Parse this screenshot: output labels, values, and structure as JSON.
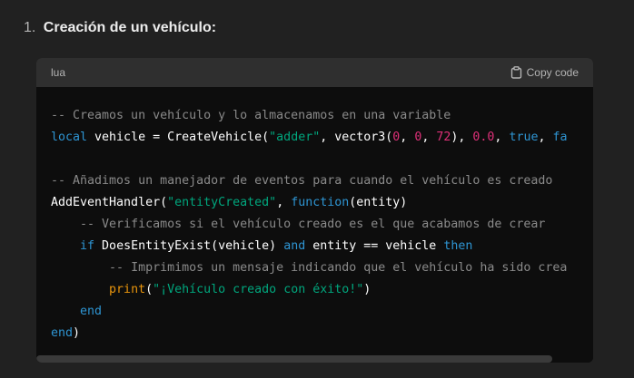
{
  "list_item": {
    "number": "1.",
    "text": "Creación de un vehículo:"
  },
  "code_block": {
    "language": "lua",
    "copy_label": "Copy code",
    "copy_icon": "clipboard-icon",
    "lines": [
      [
        {
          "t": "-- Creamos un vehículo y lo almacenamos en una variable",
          "c": "comment"
        }
      ],
      [
        {
          "t": "local",
          "c": "keyword"
        },
        {
          "t": " vehicle = CreateVehicle(",
          "c": "plain"
        },
        {
          "t": "\"adder\"",
          "c": "string"
        },
        {
          "t": ", vector3(",
          "c": "plain"
        },
        {
          "t": "0",
          "c": "number"
        },
        {
          "t": ", ",
          "c": "plain"
        },
        {
          "t": "0",
          "c": "number"
        },
        {
          "t": ", ",
          "c": "plain"
        },
        {
          "t": "72",
          "c": "number"
        },
        {
          "t": "), ",
          "c": "plain"
        },
        {
          "t": "0.0",
          "c": "number"
        },
        {
          "t": ", ",
          "c": "plain"
        },
        {
          "t": "true",
          "c": "keyword"
        },
        {
          "t": ", ",
          "c": "plain"
        },
        {
          "t": "fa",
          "c": "keyword"
        }
      ],
      [
        {
          "t": "",
          "c": "plain"
        }
      ],
      [
        {
          "t": "-- Añadimos un manejador de eventos para cuando el vehículo es creado",
          "c": "comment"
        }
      ],
      [
        {
          "t": "AddEventHandler(",
          "c": "plain"
        },
        {
          "t": "\"entityCreated\"",
          "c": "string"
        },
        {
          "t": ", ",
          "c": "plain"
        },
        {
          "t": "function",
          "c": "keyword"
        },
        {
          "t": "(entity)",
          "c": "plain"
        }
      ],
      [
        {
          "t": "    ",
          "c": "plain"
        },
        {
          "t": "-- Verificamos si el vehículo creado es el que acabamos de crear",
          "c": "comment"
        }
      ],
      [
        {
          "t": "    ",
          "c": "plain"
        },
        {
          "t": "if",
          "c": "keyword"
        },
        {
          "t": " DoesEntityExist(vehicle) ",
          "c": "plain"
        },
        {
          "t": "and",
          "c": "keyword"
        },
        {
          "t": " entity == vehicle ",
          "c": "plain"
        },
        {
          "t": "then",
          "c": "keyword"
        }
      ],
      [
        {
          "t": "        ",
          "c": "plain"
        },
        {
          "t": "-- Imprimimos un mensaje indicando que el vehículo ha sido crea",
          "c": "comment"
        }
      ],
      [
        {
          "t": "        ",
          "c": "plain"
        },
        {
          "t": "print",
          "c": "builtin"
        },
        {
          "t": "(",
          "c": "plain"
        },
        {
          "t": "\"¡Vehículo creado con éxito!\"",
          "c": "string"
        },
        {
          "t": ")",
          "c": "plain"
        }
      ],
      [
        {
          "t": "    ",
          "c": "plain"
        },
        {
          "t": "end",
          "c": "keyword"
        }
      ],
      [
        {
          "t": "end",
          "c": "keyword"
        },
        {
          "t": ")",
          "c": "plain"
        }
      ]
    ]
  }
}
